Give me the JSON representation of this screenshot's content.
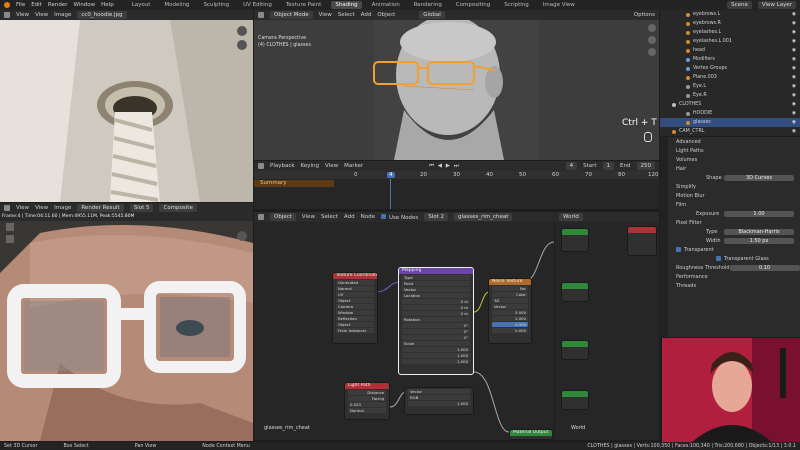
{
  "topbar": {
    "menus": [
      "File",
      "Edit",
      "Render",
      "Window",
      "Help"
    ],
    "workspace_tabs": [
      "Layout",
      "Modeling",
      "Sculpting",
      "UV Editing",
      "Texture Paint",
      "Shading",
      "Animation",
      "Rendering",
      "Compositing",
      "Scripting",
      "Image View"
    ],
    "active_tab": "Shading",
    "scene": "Scene",
    "view_layer": "View Layer"
  },
  "image_editor_top": {
    "menus": [
      "View",
      "View",
      "Image"
    ],
    "image_name": "cc0_hoodie.jpg"
  },
  "image_editor_bottom": {
    "menus": [
      "View",
      "View",
      "Image"
    ],
    "image_name": "Render Result",
    "slot": "Slot 5",
    "composite": "Composite",
    "status": "Frame:4 | Time:04:11.60 | Mem:4955.11M, Peak:5545.80M"
  },
  "viewport": {
    "mode": "Object Mode",
    "menus": [
      "View",
      "Select",
      "Add",
      "Object"
    ],
    "orientation": "Global",
    "options": "Options",
    "camera_label": "Camera Perspective",
    "object_label": "(4) CLOTHES | glasses",
    "shortcut_overlay": "Ctrl + T"
  },
  "timeline": {
    "menus": [
      "Playback",
      "Keying",
      "View",
      "Marker"
    ],
    "summary": "Summary",
    "current_frame": "4",
    "start_label": "Start",
    "start": "1",
    "end_label": "End",
    "end": "250",
    "ticks": [
      "0",
      "10",
      "20",
      "30",
      "40",
      "50",
      "60",
      "70",
      "80",
      "90",
      "100",
      "110",
      "120"
    ]
  },
  "node_editor": {
    "object_dropdown": "Object",
    "menus": [
      "View",
      "Select",
      "Add",
      "Node"
    ],
    "use_nodes": "Use Nodes",
    "slot": "Slot 2",
    "material": "glasses_rim_cheat",
    "world_dropdown": "World",
    "material_label": "glasses_rim_cheat",
    "world_label": "World",
    "nodes": {
      "texcoord": {
        "title": "Texture Coordinate",
        "rows": [
          "Generated",
          "Normal",
          "UV",
          "Object",
          "Camera",
          "Window",
          "Reflection",
          "Object",
          "From Instancer"
        ]
      },
      "mapping": {
        "title": "Mapping",
        "rows": [
          "Type",
          "Point",
          "Vector",
          "Location",
          "X",
          "Y",
          "Z",
          "Rotation",
          "X",
          "Y",
          "Z",
          "Scale",
          "X",
          "Y",
          "Z"
        ],
        "values": [
          "0 m",
          "0 m",
          "0 m",
          "0°",
          "0°",
          "0°",
          "1.000",
          "1.000",
          "1.000"
        ]
      },
      "noise": {
        "title": "Noise Texture",
        "rows": [
          "Fac",
          "Color",
          "3D",
          "fBM",
          "Vector",
          "Scale",
          "Detail",
          "Roughness",
          "Lacunarity",
          "Distortion"
        ],
        "values": [
          "5.000",
          "2.000",
          "0.500",
          "2.000",
          "0.000"
        ]
      },
      "lightpath": {
        "title": "Light Path",
        "rows": [
          "Distance",
          "Facing",
          "Normal"
        ],
        "blend_value": "0.020"
      },
      "mix": {
        "rows": [
          "RGB",
          "Fac"
        ],
        "mode": "Vector",
        "mix_value": "1.000"
      },
      "output": {
        "title": "Material Output",
        "rows": [
          "Shader",
          "Volume"
        ]
      }
    }
  },
  "outliner": {
    "items": [
      {
        "name": "eyebrows.L",
        "color": "#d08c30"
      },
      {
        "name": "eyebrows.R",
        "color": "#d08c30"
      },
      {
        "name": "eyelashes.L",
        "color": "#d08c30"
      },
      {
        "name": "eyelashes.L.001",
        "color": "#d08c30"
      },
      {
        "name": "head",
        "color": "#d08c30"
      },
      {
        "name": "Modifiers",
        "color": "#6b9fe0"
      },
      {
        "name": "Vertex Groups",
        "color": "#6b9fe0"
      },
      {
        "name": "Plane.003",
        "color": "#d08c30"
      },
      {
        "name": "Eye.L",
        "color": "#999999"
      },
      {
        "name": "Eye.R",
        "color": "#999999"
      },
      {
        "name": "CLOTHES",
        "color": "#bbbbbb"
      },
      {
        "name": "HOODIE",
        "color": "#999999"
      },
      {
        "name": "glasses",
        "color": "#d08c30"
      },
      {
        "name": "CAM_CTRL",
        "color": "#d08c30"
      }
    ],
    "selected_index": 12
  },
  "properties": {
    "sections": [
      "Advanced",
      "Light Paths",
      "Volumes",
      "Hair"
    ],
    "shape_label": "Shape",
    "shape_value": "3D Curves",
    "subsections": [
      "Simplify",
      "Motion Blur",
      "Film"
    ],
    "exposure_label": "Exposure",
    "exposure_value": "1.00",
    "pixel_filter": "Pixel Filter",
    "type_label": "Type",
    "type_value": "Blackman-Harris",
    "width_label": "Width",
    "width_value": "1.50 px",
    "transparent": "Transparent",
    "transparent_glass": "Transparent Glass",
    "roughness_label": "Roughness Threshold",
    "roughness_value": "0.10",
    "performance": "Performance",
    "threads": "Threads"
  },
  "statusbar": {
    "left": [
      "Set 3D Cursor",
      "Box Select",
      "Pan View",
      "Node Context Menu"
    ],
    "right": "CLOTHES | glasses | Verts:100,350 | Faces:100,340 | Tris:200,680 | Objects:1/13 | 3.0.1"
  },
  "colors": {
    "accent": "#4772b3",
    "selection_orange": "#f0a030",
    "playhead": "#4772b3",
    "webcam_bg": "#b8204a"
  }
}
